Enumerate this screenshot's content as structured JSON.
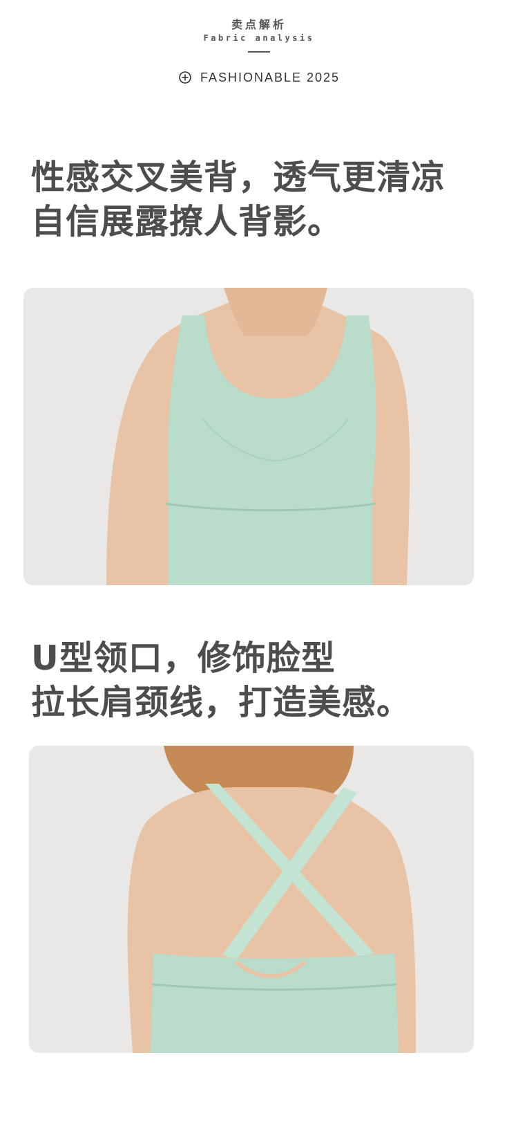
{
  "header": {
    "zh_title": "卖点解析",
    "en_title": "Fabric analysis",
    "fashion_label": "FASHIONABLE  2025",
    "icon": "plus-circle-icon"
  },
  "section1": {
    "headline_lines": [
      "性感交叉美背，透气更清凉",
      "自信展露撩人背影。"
    ]
  },
  "section2": {
    "headline_lines": [
      "U型领口，修饰脸型",
      "拉长肩颈线，打造美感。"
    ]
  },
  "colors": {
    "text": "#4d4d4d",
    "photo_background": "#e9e8e6",
    "garment_mint": "#b9dccb",
    "skin": "#e8c3a6"
  }
}
